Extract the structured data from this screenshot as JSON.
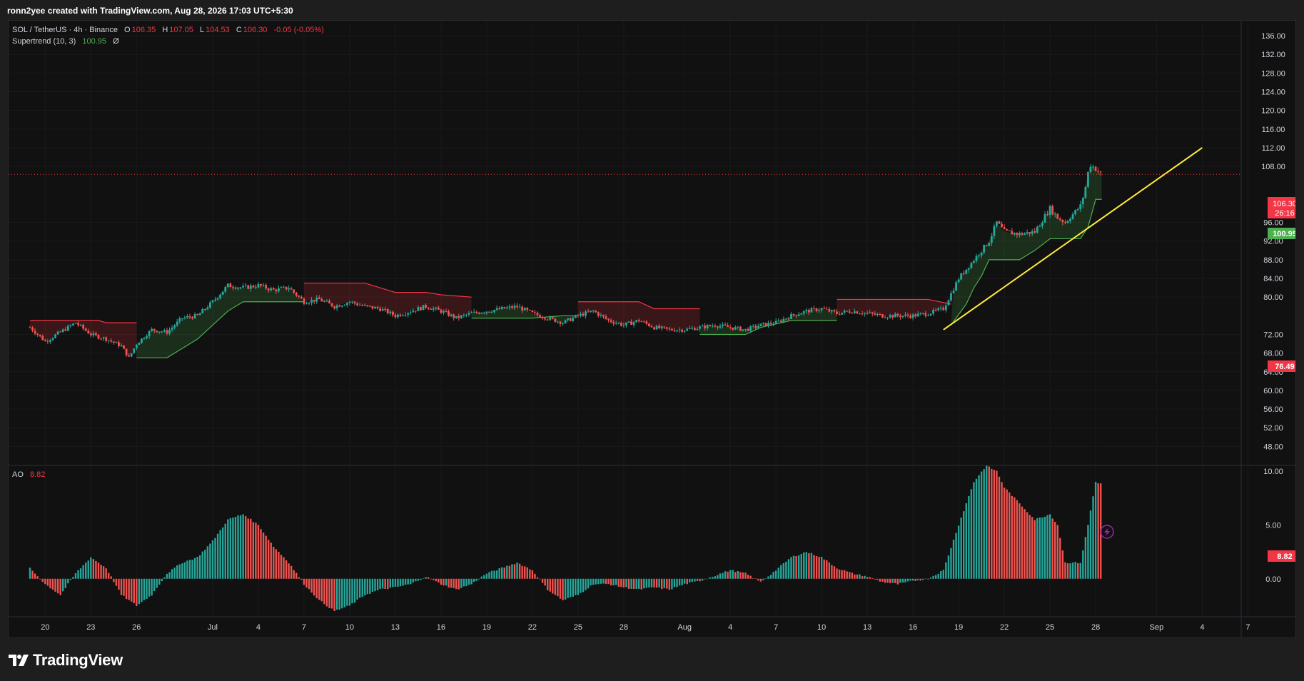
{
  "header": {
    "text": "ronn2yee created with TradingView.com, Aug 28, 2026 17:03 UTC+5:30"
  },
  "legend": {
    "symbol": "SOL / TetherUS · 4h · Binance",
    "o_label": "O",
    "o": "106.35",
    "h_label": "H",
    "h": "107.05",
    "l_label": "L",
    "l": "104.53",
    "c_label": "C",
    "c": "106.30",
    "change": "-0.05 (-0.05%)",
    "indicator": "Supertrend (10, 3)",
    "indicator_value": "100.95",
    "indicator_flag": "Ø",
    "ao_name": "AO",
    "ao_value": "8.82"
  },
  "colors": {
    "background": "#111111",
    "bull": "#26a69a",
    "bear": "#ef5350",
    "supertrend_up": "#4caf50",
    "supertrend_down": "#f23645",
    "trendline": "#ffeb3b",
    "last_price_badge": "#f23645",
    "supertrend_badge": "#4caf50"
  },
  "badges": {
    "last_price": "106.30",
    "countdown": "26:16",
    "supertrend": "100.95",
    "price_line": "76.49",
    "ao_last": "8.82"
  },
  "icons": {
    "alert_marker": "lightning-icon",
    "logo": "tradingview-logo-icon"
  },
  "footer": {
    "logo_text": "TradingView"
  },
  "chart_data": {
    "type": "candlestick",
    "price_axis": {
      "ticks": [
        "136.00",
        "132.00",
        "128.00",
        "124.00",
        "120.00",
        "116.00",
        "112.00",
        "108.00",
        "96.00",
        "92.00",
        "88.00",
        "84.00",
        "80.00",
        "72.00",
        "68.00",
        "64.00",
        "60.00",
        "56.00",
        "52.00",
        "48.00"
      ],
      "range": [
        45,
        138
      ]
    },
    "ao_axis": {
      "ticks": [
        "10.00",
        "5.00",
        "0.00"
      ],
      "range": [
        -3.2,
        10.2
      ]
    },
    "time_axis": {
      "labels": [
        "20",
        "23",
        "26",
        "Jul",
        "4",
        "7",
        "10",
        "13",
        "16",
        "19",
        "22",
        "25",
        "28",
        "Aug",
        "4",
        "7",
        "10",
        "13",
        "16",
        "19",
        "22",
        "25",
        "28",
        "Sep",
        "4",
        "7"
      ],
      "day_index": [
        1,
        4,
        7,
        12,
        15,
        18,
        21,
        24,
        27,
        30,
        33,
        36,
        39,
        43,
        46,
        49,
        52,
        55,
        58,
        61,
        64,
        67,
        70,
        74,
        77,
        80
      ],
      "first_day": "Jun 19",
      "bar_interval": "4h"
    },
    "price_path": [
      [
        0.0,
        73.5
      ],
      [
        1.0,
        70.5
      ],
      [
        2.0,
        72.5
      ],
      [
        3.0,
        74.5
      ],
      [
        4.0,
        72.0
      ],
      [
        5.0,
        71.0
      ],
      [
        6.0,
        69.5
      ],
      [
        6.5,
        67.0
      ],
      [
        7.0,
        70.0
      ],
      [
        8.0,
        73.0
      ],
      [
        9.0,
        72.5
      ],
      [
        10.0,
        75.5
      ],
      [
        11.0,
        76.0
      ],
      [
        12.0,
        79.0
      ],
      [
        13.0,
        82.5
      ],
      [
        14.0,
        82.0
      ],
      [
        15.0,
        82.5
      ],
      [
        16.0,
        81.5
      ],
      [
        17.0,
        82.0
      ],
      [
        18.0,
        79.0
      ],
      [
        19.0,
        79.5
      ],
      [
        20.0,
        78.0
      ],
      [
        21.0,
        79.0
      ],
      [
        22.0,
        78.0
      ],
      [
        23.0,
        77.5
      ],
      [
        24.0,
        76.0
      ],
      [
        25.0,
        77.0
      ],
      [
        26.0,
        78.0
      ],
      [
        27.0,
        77.0
      ],
      [
        28.0,
        75.5
      ],
      [
        29.0,
        76.5
      ],
      [
        30.0,
        77.0
      ],
      [
        31.0,
        77.5
      ],
      [
        32.0,
        78.0
      ],
      [
        33.0,
        76.5
      ],
      [
        34.0,
        75.5
      ],
      [
        35.0,
        74.5
      ],
      [
        36.0,
        76.0
      ],
      [
        37.0,
        77.0
      ],
      [
        38.0,
        75.0
      ],
      [
        39.0,
        74.0
      ],
      [
        40.0,
        75.0
      ],
      [
        41.0,
        73.5
      ],
      [
        42.0,
        73.0
      ],
      [
        43.0,
        73.0
      ],
      [
        44.0,
        73.5
      ],
      [
        45.0,
        74.0
      ],
      [
        46.0,
        73.5
      ],
      [
        47.0,
        73.0
      ],
      [
        48.0,
        74.0
      ],
      [
        49.0,
        74.5
      ],
      [
        50.0,
        76.0
      ],
      [
        51.0,
        77.0
      ],
      [
        52.0,
        77.5
      ],
      [
        53.0,
        76.5
      ],
      [
        54.0,
        77.0
      ],
      [
        55.0,
        76.5
      ],
      [
        56.0,
        76.0
      ],
      [
        57.0,
        76.0
      ],
      [
        58.0,
        76.0
      ],
      [
        59.0,
        76.5
      ],
      [
        60.0,
        77.5
      ],
      [
        61.0,
        84.0
      ],
      [
        62.0,
        88.0
      ],
      [
        63.0,
        92.0
      ],
      [
        63.5,
        96.0
      ],
      [
        64.0,
        94.0
      ],
      [
        65.0,
        93.5
      ],
      [
        66.0,
        94.0
      ],
      [
        67.0,
        99.0
      ],
      [
        67.5,
        97.0
      ],
      [
        68.0,
        96.0
      ],
      [
        69.0,
        99.5
      ],
      [
        69.3,
        103.0
      ],
      [
        69.6,
        108.5
      ],
      [
        70.0,
        107.5
      ],
      [
        70.4,
        106.3
      ]
    ],
    "supertrend": [
      {
        "trend": "down",
        "points": [
          [
            0.0,
            75.0
          ],
          [
            4.5,
            75.0
          ],
          [
            5.0,
            74.5
          ],
          [
            7.0,
            74.5
          ]
        ]
      },
      {
        "trend": "up",
        "points": [
          [
            7.0,
            67.0
          ],
          [
            9.0,
            67.0
          ],
          [
            10.0,
            69.0
          ],
          [
            11.0,
            71.0
          ],
          [
            12.0,
            74.0
          ],
          [
            13.0,
            77.0
          ],
          [
            14.0,
            79.0
          ],
          [
            18.0,
            79.0
          ]
        ]
      },
      {
        "trend": "down",
        "points": [
          [
            18.0,
            83.0
          ],
          [
            22.0,
            83.0
          ],
          [
            24.0,
            81.0
          ],
          [
            26.0,
            81.0
          ],
          [
            27.0,
            80.5
          ],
          [
            29.0,
            80.0
          ]
        ]
      },
      {
        "trend": "up",
        "points": [
          [
            29.0,
            75.5
          ],
          [
            33.0,
            75.5
          ],
          [
            35.0,
            76.0
          ],
          [
            36.0,
            76.0
          ]
        ]
      },
      {
        "trend": "down",
        "points": [
          [
            36.0,
            79.0
          ],
          [
            40.0,
            79.0
          ],
          [
            41.0,
            77.5
          ],
          [
            44.0,
            77.5
          ]
        ]
      },
      {
        "trend": "up",
        "points": [
          [
            44.0,
            72.0
          ],
          [
            47.0,
            72.0
          ],
          [
            48.0,
            73.5
          ],
          [
            50.0,
            75.0
          ],
          [
            53.0,
            75.0
          ]
        ]
      },
      {
        "trend": "down",
        "points": [
          [
            53.0,
            79.5
          ],
          [
            59.0,
            79.5
          ],
          [
            60.5,
            78.5
          ]
        ]
      },
      {
        "trend": "up",
        "points": [
          [
            60.5,
            74.0
          ],
          [
            61.5,
            78.5
          ],
          [
            62.0,
            82.0
          ],
          [
            62.5,
            84.5
          ],
          [
            63.0,
            88.0
          ],
          [
            65.0,
            88.0
          ],
          [
            66.0,
            90.0
          ],
          [
            67.0,
            92.5
          ],
          [
            69.0,
            92.5
          ],
          [
            69.5,
            95.0
          ],
          [
            70.0,
            100.95
          ],
          [
            70.4,
            100.95
          ]
        ]
      }
    ],
    "trendline": {
      "start": [
        60.0,
        73.0
      ],
      "end": [
        77.0,
        112.0
      ]
    },
    "price_line": 76.49,
    "ao_path": [
      [
        0.0,
        1.0
      ],
      [
        1.0,
        -0.5
      ],
      [
        2.0,
        -1.5
      ],
      [
        3.0,
        0.5
      ],
      [
        4.0,
        2.0
      ],
      [
        5.0,
        1.0
      ],
      [
        6.0,
        -1.5
      ],
      [
        7.0,
        -2.5
      ],
      [
        8.0,
        -1.5
      ],
      [
        9.0,
        0.5
      ],
      [
        10.0,
        1.5
      ],
      [
        11.0,
        2.0
      ],
      [
        12.0,
        3.5
      ],
      [
        13.0,
        5.5
      ],
      [
        14.0,
        6.0
      ],
      [
        15.0,
        5.0
      ],
      [
        16.0,
        3.0
      ],
      [
        17.0,
        1.5
      ],
      [
        18.0,
        -0.5
      ],
      [
        19.0,
        -2.0
      ],
      [
        20.0,
        -3.0
      ],
      [
        21.0,
        -2.5
      ],
      [
        22.0,
        -1.5
      ],
      [
        23.0,
        -1.0
      ],
      [
        24.0,
        -0.8
      ],
      [
        25.0,
        -0.5
      ],
      [
        26.0,
        0.2
      ],
      [
        27.0,
        -0.5
      ],
      [
        28.0,
        -1.0
      ],
      [
        29.0,
        -0.5
      ],
      [
        30.0,
        0.5
      ],
      [
        31.0,
        1.0
      ],
      [
        32.0,
        1.5
      ],
      [
        33.0,
        0.8
      ],
      [
        34.0,
        -1.0
      ],
      [
        35.0,
        -2.0
      ],
      [
        36.0,
        -1.5
      ],
      [
        37.0,
        -0.5
      ],
      [
        38.0,
        -0.5
      ],
      [
        39.0,
        -0.8
      ],
      [
        40.0,
        -1.0
      ],
      [
        41.0,
        -0.8
      ],
      [
        42.0,
        -1.0
      ],
      [
        43.0,
        -0.5
      ],
      [
        44.0,
        -0.2
      ],
      [
        45.0,
        0.3
      ],
      [
        46.0,
        0.8
      ],
      [
        47.0,
        0.5
      ],
      [
        48.0,
        -0.3
      ],
      [
        49.0,
        0.8
      ],
      [
        50.0,
        2.0
      ],
      [
        51.0,
        2.5
      ],
      [
        52.0,
        2.0
      ],
      [
        53.0,
        1.0
      ],
      [
        54.0,
        0.5
      ],
      [
        55.0,
        0.2
      ],
      [
        56.0,
        -0.3
      ],
      [
        57.0,
        -0.5
      ],
      [
        58.0,
        -0.2
      ],
      [
        59.0,
        0.0
      ],
      [
        60.0,
        0.8
      ],
      [
        61.0,
        5.0
      ],
      [
        62.0,
        9.0
      ],
      [
        62.8,
        10.5
      ],
      [
        63.5,
        10.0
      ],
      [
        64.0,
        8.5
      ],
      [
        65.0,
        7.0
      ],
      [
        66.0,
        5.5
      ],
      [
        67.0,
        6.0
      ],
      [
        67.5,
        5.0
      ],
      [
        68.0,
        1.5
      ],
      [
        69.0,
        1.5
      ],
      [
        69.5,
        5.0
      ],
      [
        70.0,
        9.0
      ],
      [
        70.4,
        8.82
      ]
    ]
  }
}
